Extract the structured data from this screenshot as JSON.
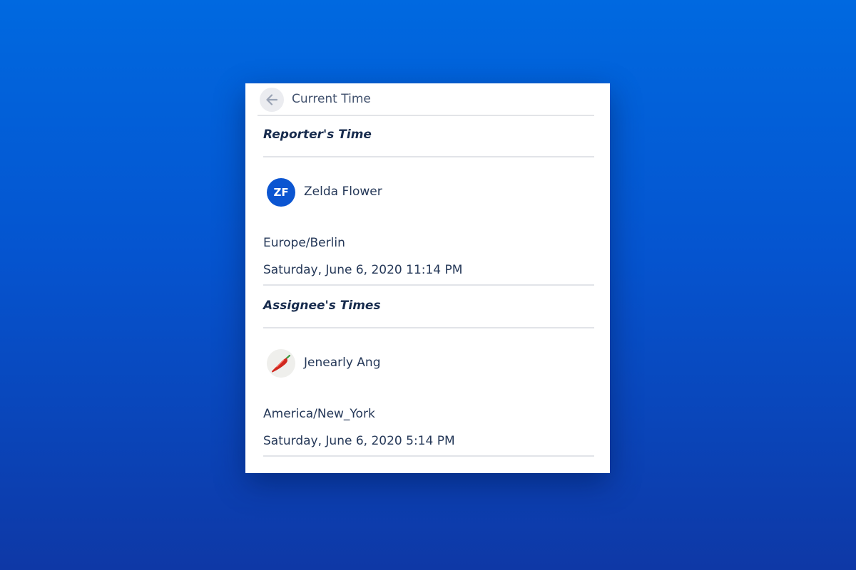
{
  "header": {
    "back_icon": "arrow-left-icon",
    "title": "Current Time"
  },
  "reporter": {
    "section_title": "Reporter's Time",
    "user": {
      "initials": "ZF",
      "name": "Zelda Flower",
      "avatar_color": "#0b55d1"
    },
    "timezone": "Europe/Berlin",
    "datetime": "Saturday, June 6, 2020 11:14 PM"
  },
  "assignee": {
    "section_title": "Assignee's Times",
    "user": {
      "name": "Jenearly Ang",
      "avatar_icon": "chili-pepper-icon"
    },
    "timezone": "America/New_York",
    "datetime": "Saturday, June 6, 2020 5:14 PM"
  },
  "colors": {
    "background_top": "#0069e0",
    "background_bottom": "#0e38a6",
    "panel": "#ffffff",
    "heading_text": "#172b4d",
    "body_text": "#253858",
    "divider": "#e2e4e8"
  }
}
